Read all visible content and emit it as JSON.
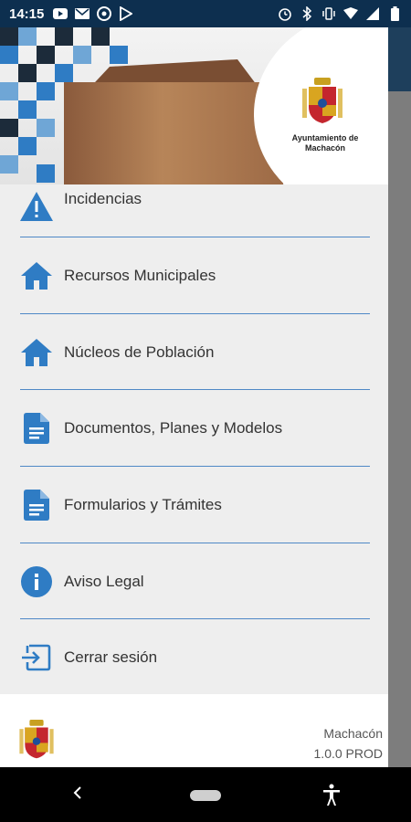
{
  "status_bar": {
    "time": "14:15",
    "left_icons": [
      "youtube-icon",
      "mail-icon",
      "at-icon",
      "play-store-icon"
    ],
    "right_icons": [
      "alarm-icon",
      "bluetooth-icon",
      "vibrate-icon",
      "wifi-icon",
      "signal-icon",
      "battery-icon"
    ]
  },
  "header": {
    "caption_line1": "Ayuntamiento de",
    "caption_line2": "Machacón"
  },
  "menu": {
    "items": [
      {
        "label": "Incidencias",
        "icon": "warning-icon"
      },
      {
        "label": "Recursos Municipales",
        "icon": "home-icon"
      },
      {
        "label": "Núcleos de Población",
        "icon": "home-icon"
      },
      {
        "label": "Documentos, Planes y Modelos",
        "icon": "document-icon"
      },
      {
        "label": "Formularios y Trámites",
        "icon": "document-icon"
      },
      {
        "label": "Aviso Legal",
        "icon": "info-icon"
      },
      {
        "label": "Cerrar sesión",
        "icon": "logout-icon"
      }
    ]
  },
  "footer": {
    "town": "Machacón",
    "version": "1.0.0 PROD"
  },
  "colors": {
    "accent": "#2f7cc4",
    "status_bar": "#0d2f4f",
    "drawer_bg": "#eeeeee"
  }
}
